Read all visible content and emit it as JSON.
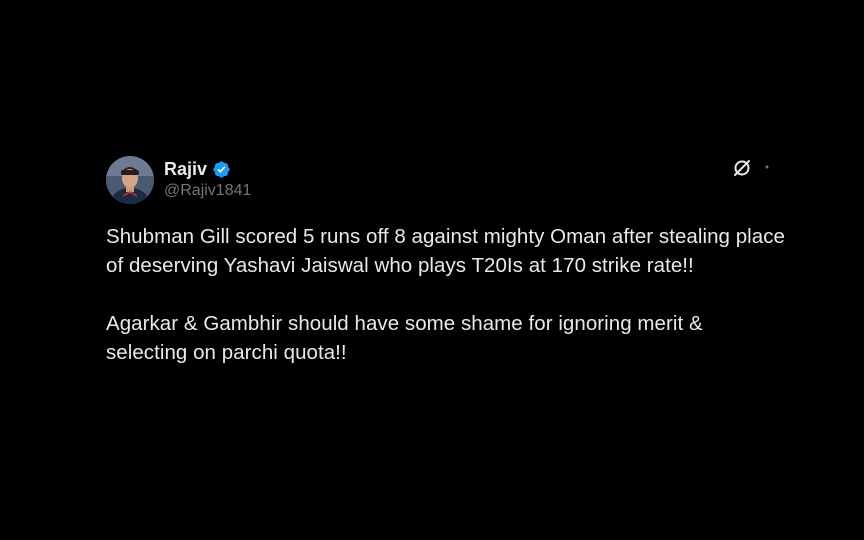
{
  "author": {
    "display_name": "Rajiv",
    "handle": "@Rajiv1841",
    "verified": true,
    "avatar_icon": "profile-photo-cricketer"
  },
  "tweet": {
    "paragraphs": [
      "Shubman Gill scored 5 runs off 8 against mighty Oman after stealing place of deserving Yashavi Jaiswal who plays T20Is at 170 strike rate!!",
      "Agarkar & Gambhir should have some shame for ignoring merit & selecting on parchi quota!!"
    ]
  },
  "icons": {
    "verified": "verified-badge-icon",
    "grok": "grok-icon",
    "more": "more-icon"
  },
  "colors": {
    "background": "#000000",
    "text": "#e7e9ea",
    "secondary_text": "#71767b",
    "verified_blue": "#1d9bf0"
  }
}
